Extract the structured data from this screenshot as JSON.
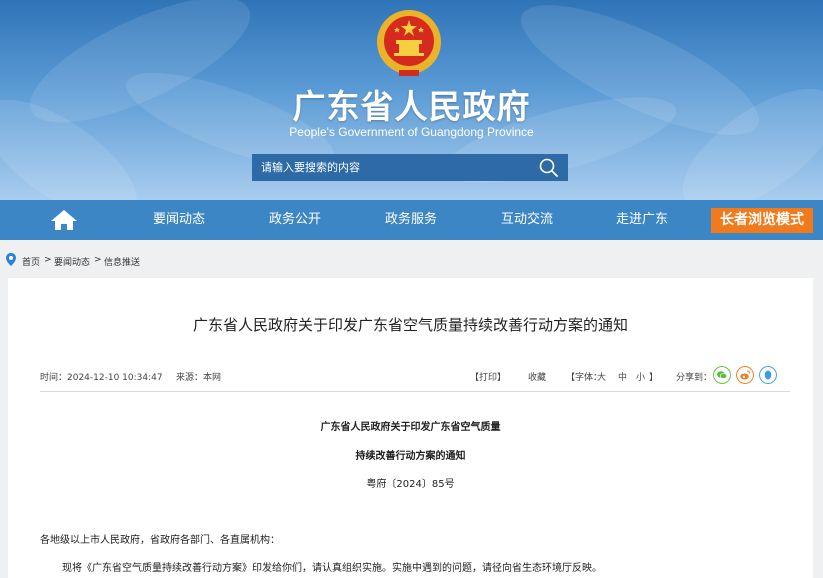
{
  "header": {
    "title": "广东省人民政府",
    "subtitle": "People's Government of Guangdong Province",
    "search_placeholder": "请输入要搜索的内容"
  },
  "nav": {
    "items": [
      "要闻动态",
      "政务公开",
      "政务服务",
      "互动交流",
      "走进广东"
    ],
    "elder_mode": "长者浏览模式"
  },
  "breadcrumb": {
    "items": [
      "首页",
      "要闻动态",
      "信息推送"
    ],
    "separator": ">"
  },
  "article": {
    "title": "广东省人民政府关于印发广东省空气质量持续改善行动方案的通知",
    "time": "时间：2024-12-10 10:34:47",
    "source": "来源：本网",
    "print": "【打印】",
    "collect": "收藏",
    "font_label": "【字体：",
    "font_large": "大",
    "font_medium": "中",
    "font_small": "小",
    "font_close": "】",
    "share_label": "分享到：",
    "doc_title_line1": "广东省人民政府关于印发广东省空气质量",
    "doc_title_line2": "持续改善行动方案的通知",
    "doc_number": "粤府〔2024〕85号",
    "salutation": "各地级以上市人民政府，省政府各部门、各直属机构：",
    "body_line1": "现将《广东省空气质量持续改善行动方案》印发给你们，请认真组织实施。实施中遇到的问题，请径向省生态环境厅反映。"
  },
  "colors": {
    "nav_bg": "#3d86c6",
    "elder_bg": "#f07a1c",
    "wechat": "#5bbf3c",
    "weibo": "#f07a1c",
    "qq": "#3d9be0"
  }
}
